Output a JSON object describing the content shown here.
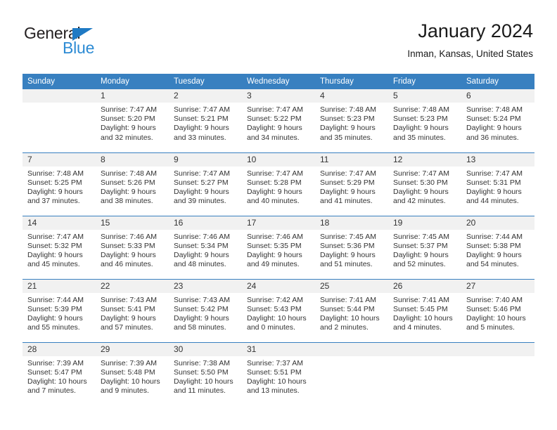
{
  "brand": {
    "name_dark": "General",
    "name_light": "Blue",
    "accent_color": "#2d8bd4",
    "triangle_color": "#1f7ac4"
  },
  "header": {
    "title": "January 2024",
    "subtitle": "Inman, Kansas, United States"
  },
  "calendar": {
    "header_bg": "#3880c0",
    "daynum_bg": "#f1f1f1",
    "weekday_headers": [
      "Sunday",
      "Monday",
      "Tuesday",
      "Wednesday",
      "Thursday",
      "Friday",
      "Saturday"
    ],
    "weeks": [
      [
        {
          "day": "",
          "sunrise": "",
          "sunset": "",
          "daylight_line1": "",
          "daylight_line2": ""
        },
        {
          "day": "1",
          "sunrise": "Sunrise: 7:47 AM",
          "sunset": "Sunset: 5:20 PM",
          "daylight_line1": "Daylight: 9 hours",
          "daylight_line2": "and 32 minutes."
        },
        {
          "day": "2",
          "sunrise": "Sunrise: 7:47 AM",
          "sunset": "Sunset: 5:21 PM",
          "daylight_line1": "Daylight: 9 hours",
          "daylight_line2": "and 33 minutes."
        },
        {
          "day": "3",
          "sunrise": "Sunrise: 7:47 AM",
          "sunset": "Sunset: 5:22 PM",
          "daylight_line1": "Daylight: 9 hours",
          "daylight_line2": "and 34 minutes."
        },
        {
          "day": "4",
          "sunrise": "Sunrise: 7:48 AM",
          "sunset": "Sunset: 5:23 PM",
          "daylight_line1": "Daylight: 9 hours",
          "daylight_line2": "and 35 minutes."
        },
        {
          "day": "5",
          "sunrise": "Sunrise: 7:48 AM",
          "sunset": "Sunset: 5:23 PM",
          "daylight_line1": "Daylight: 9 hours",
          "daylight_line2": "and 35 minutes."
        },
        {
          "day": "6",
          "sunrise": "Sunrise: 7:48 AM",
          "sunset": "Sunset: 5:24 PM",
          "daylight_line1": "Daylight: 9 hours",
          "daylight_line2": "and 36 minutes."
        }
      ],
      [
        {
          "day": "7",
          "sunrise": "Sunrise: 7:48 AM",
          "sunset": "Sunset: 5:25 PM",
          "daylight_line1": "Daylight: 9 hours",
          "daylight_line2": "and 37 minutes."
        },
        {
          "day": "8",
          "sunrise": "Sunrise: 7:48 AM",
          "sunset": "Sunset: 5:26 PM",
          "daylight_line1": "Daylight: 9 hours",
          "daylight_line2": "and 38 minutes."
        },
        {
          "day": "9",
          "sunrise": "Sunrise: 7:47 AM",
          "sunset": "Sunset: 5:27 PM",
          "daylight_line1": "Daylight: 9 hours",
          "daylight_line2": "and 39 minutes."
        },
        {
          "day": "10",
          "sunrise": "Sunrise: 7:47 AM",
          "sunset": "Sunset: 5:28 PM",
          "daylight_line1": "Daylight: 9 hours",
          "daylight_line2": "and 40 minutes."
        },
        {
          "day": "11",
          "sunrise": "Sunrise: 7:47 AM",
          "sunset": "Sunset: 5:29 PM",
          "daylight_line1": "Daylight: 9 hours",
          "daylight_line2": "and 41 minutes."
        },
        {
          "day": "12",
          "sunrise": "Sunrise: 7:47 AM",
          "sunset": "Sunset: 5:30 PM",
          "daylight_line1": "Daylight: 9 hours",
          "daylight_line2": "and 42 minutes."
        },
        {
          "day": "13",
          "sunrise": "Sunrise: 7:47 AM",
          "sunset": "Sunset: 5:31 PM",
          "daylight_line1": "Daylight: 9 hours",
          "daylight_line2": "and 44 minutes."
        }
      ],
      [
        {
          "day": "14",
          "sunrise": "Sunrise: 7:47 AM",
          "sunset": "Sunset: 5:32 PM",
          "daylight_line1": "Daylight: 9 hours",
          "daylight_line2": "and 45 minutes."
        },
        {
          "day": "15",
          "sunrise": "Sunrise: 7:46 AM",
          "sunset": "Sunset: 5:33 PM",
          "daylight_line1": "Daylight: 9 hours",
          "daylight_line2": "and 46 minutes."
        },
        {
          "day": "16",
          "sunrise": "Sunrise: 7:46 AM",
          "sunset": "Sunset: 5:34 PM",
          "daylight_line1": "Daylight: 9 hours",
          "daylight_line2": "and 48 minutes."
        },
        {
          "day": "17",
          "sunrise": "Sunrise: 7:46 AM",
          "sunset": "Sunset: 5:35 PM",
          "daylight_line1": "Daylight: 9 hours",
          "daylight_line2": "and 49 minutes."
        },
        {
          "day": "18",
          "sunrise": "Sunrise: 7:45 AM",
          "sunset": "Sunset: 5:36 PM",
          "daylight_line1": "Daylight: 9 hours",
          "daylight_line2": "and 51 minutes."
        },
        {
          "day": "19",
          "sunrise": "Sunrise: 7:45 AM",
          "sunset": "Sunset: 5:37 PM",
          "daylight_line1": "Daylight: 9 hours",
          "daylight_line2": "and 52 minutes."
        },
        {
          "day": "20",
          "sunrise": "Sunrise: 7:44 AM",
          "sunset": "Sunset: 5:38 PM",
          "daylight_line1": "Daylight: 9 hours",
          "daylight_line2": "and 54 minutes."
        }
      ],
      [
        {
          "day": "21",
          "sunrise": "Sunrise: 7:44 AM",
          "sunset": "Sunset: 5:39 PM",
          "daylight_line1": "Daylight: 9 hours",
          "daylight_line2": "and 55 minutes."
        },
        {
          "day": "22",
          "sunrise": "Sunrise: 7:43 AM",
          "sunset": "Sunset: 5:41 PM",
          "daylight_line1": "Daylight: 9 hours",
          "daylight_line2": "and 57 minutes."
        },
        {
          "day": "23",
          "sunrise": "Sunrise: 7:43 AM",
          "sunset": "Sunset: 5:42 PM",
          "daylight_line1": "Daylight: 9 hours",
          "daylight_line2": "and 58 minutes."
        },
        {
          "day": "24",
          "sunrise": "Sunrise: 7:42 AM",
          "sunset": "Sunset: 5:43 PM",
          "daylight_line1": "Daylight: 10 hours",
          "daylight_line2": "and 0 minutes."
        },
        {
          "day": "25",
          "sunrise": "Sunrise: 7:41 AM",
          "sunset": "Sunset: 5:44 PM",
          "daylight_line1": "Daylight: 10 hours",
          "daylight_line2": "and 2 minutes."
        },
        {
          "day": "26",
          "sunrise": "Sunrise: 7:41 AM",
          "sunset": "Sunset: 5:45 PM",
          "daylight_line1": "Daylight: 10 hours",
          "daylight_line2": "and 4 minutes."
        },
        {
          "day": "27",
          "sunrise": "Sunrise: 7:40 AM",
          "sunset": "Sunset: 5:46 PM",
          "daylight_line1": "Daylight: 10 hours",
          "daylight_line2": "and 5 minutes."
        }
      ],
      [
        {
          "day": "28",
          "sunrise": "Sunrise: 7:39 AM",
          "sunset": "Sunset: 5:47 PM",
          "daylight_line1": "Daylight: 10 hours",
          "daylight_line2": "and 7 minutes."
        },
        {
          "day": "29",
          "sunrise": "Sunrise: 7:39 AM",
          "sunset": "Sunset: 5:48 PM",
          "daylight_line1": "Daylight: 10 hours",
          "daylight_line2": "and 9 minutes."
        },
        {
          "day": "30",
          "sunrise": "Sunrise: 7:38 AM",
          "sunset": "Sunset: 5:50 PM",
          "daylight_line1": "Daylight: 10 hours",
          "daylight_line2": "and 11 minutes."
        },
        {
          "day": "31",
          "sunrise": "Sunrise: 7:37 AM",
          "sunset": "Sunset: 5:51 PM",
          "daylight_line1": "Daylight: 10 hours",
          "daylight_line2": "and 13 minutes."
        },
        {
          "day": "",
          "sunrise": "",
          "sunset": "",
          "daylight_line1": "",
          "daylight_line2": ""
        },
        {
          "day": "",
          "sunrise": "",
          "sunset": "",
          "daylight_line1": "",
          "daylight_line2": ""
        },
        {
          "day": "",
          "sunrise": "",
          "sunset": "",
          "daylight_line1": "",
          "daylight_line2": ""
        }
      ]
    ]
  }
}
